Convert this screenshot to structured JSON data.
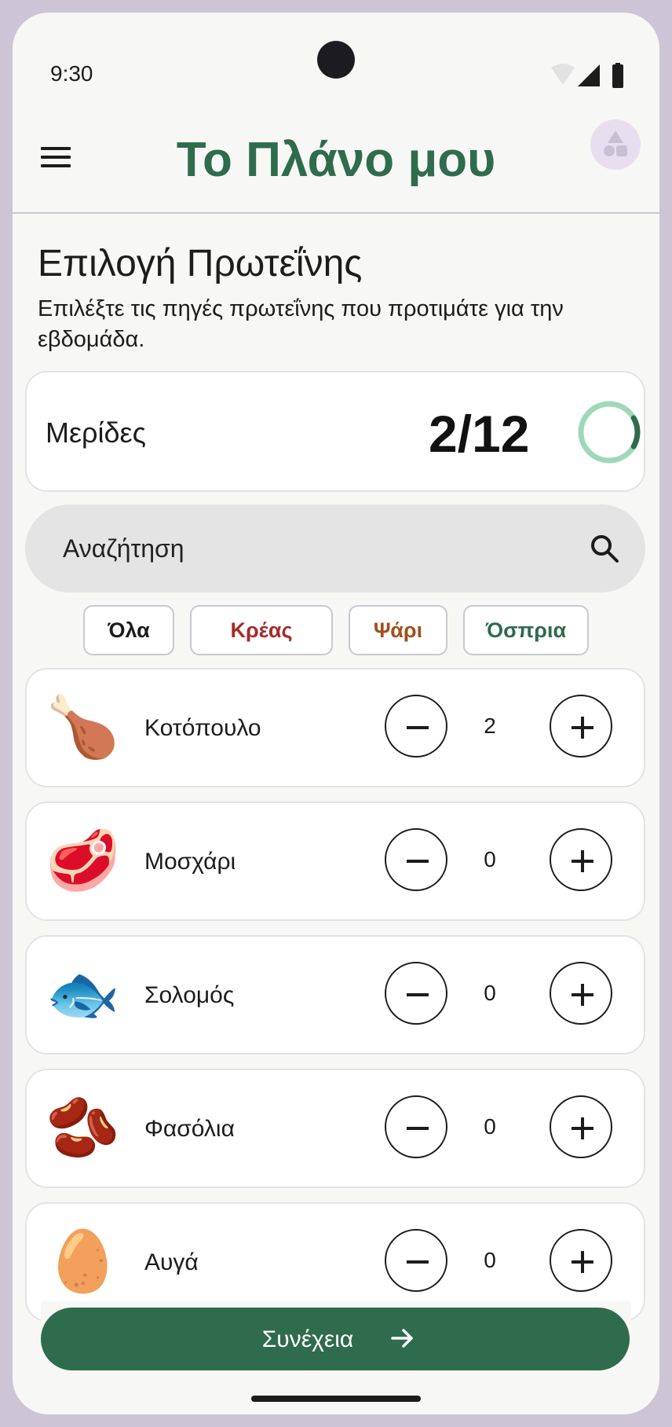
{
  "status": {
    "time": "9:30"
  },
  "appbar": {
    "title": "Το Πλάνο μου",
    "menu_icon": "hamburger-menu-icon",
    "avatar_icon": "shapes-avatar-icon"
  },
  "page": {
    "heading": "Επιλογή Πρωτεΐνης",
    "subtitle": "Επιλέξτε τις πηγές πρωτεΐνης που προτιμάτε για την εβδομάδα."
  },
  "portions": {
    "label": "Μερίδες",
    "value": "2/12",
    "selected": 2,
    "total": 12
  },
  "search": {
    "placeholder": "Αναζήτηση",
    "icon": "search-icon"
  },
  "filters": [
    {
      "label": "Όλα",
      "color": "#1c1c1c"
    },
    {
      "label": "Κρέας",
      "color": "#a52a2a"
    },
    {
      "label": "Ψάρι",
      "color": "#a0501c"
    },
    {
      "label": "Όσπρια",
      "color": "#2f6b4d"
    }
  ],
  "items": [
    {
      "name": "Κοτόπουλο",
      "emoji": "🍗",
      "icon": "chicken-leg-icon",
      "qty": "2"
    },
    {
      "name": "Μοσχάρι",
      "emoji": "🥩",
      "icon": "steak-icon",
      "qty": "0"
    },
    {
      "name": "Σολομός",
      "emoji": "🐟",
      "icon": "fish-icon",
      "qty": "0"
    },
    {
      "name": "Φασόλια",
      "emoji": "🫘",
      "icon": "beans-icon",
      "qty": "0"
    },
    {
      "name": "Αυγά",
      "emoji": "🥚",
      "icon": "egg-icon",
      "qty": "0"
    }
  ],
  "cta": {
    "label": "Συνέχεια",
    "icon": "arrow-right-icon"
  },
  "colors": {
    "brand": "#2f6b4d",
    "ring_track": "#9fd8b9",
    "ring_progress": "#2f6b4d"
  }
}
